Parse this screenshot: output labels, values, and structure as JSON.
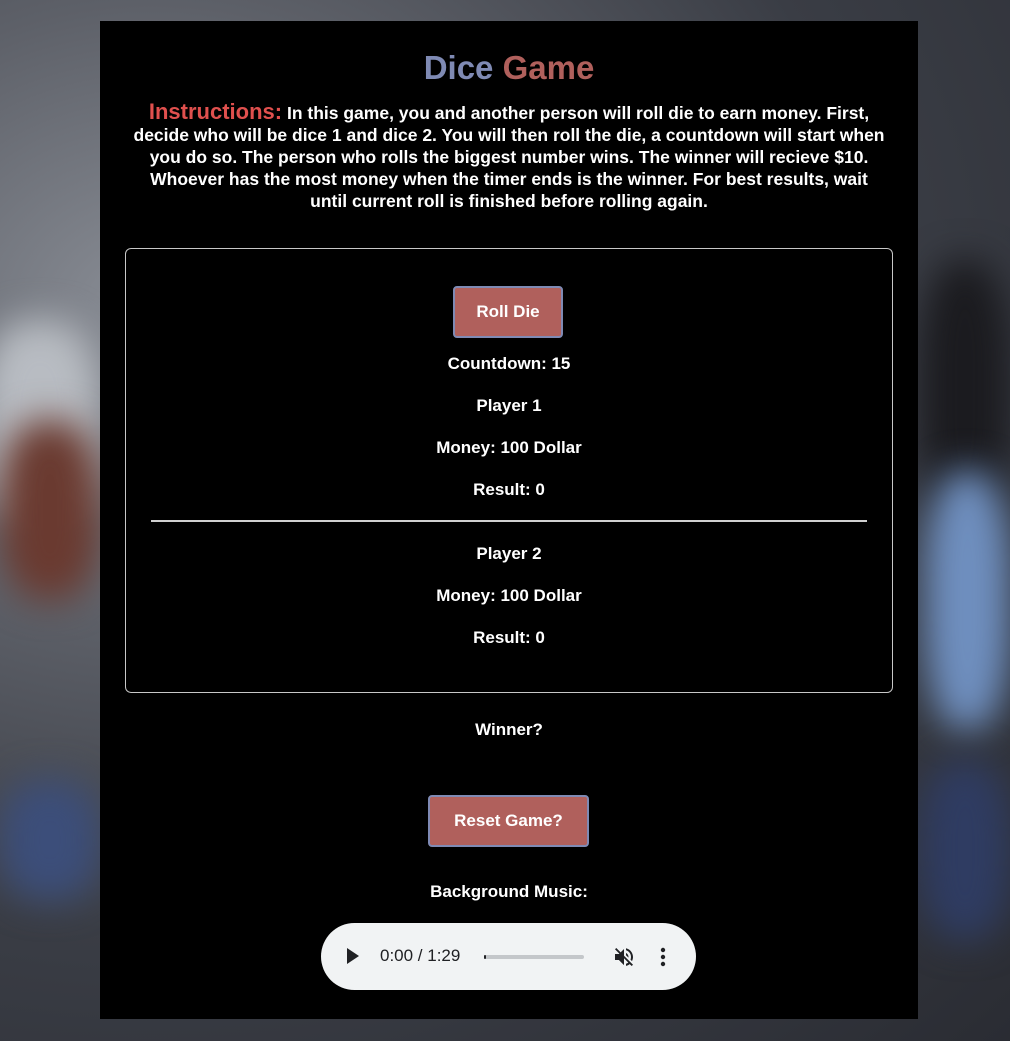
{
  "title": {
    "part1": "Dice",
    "part2": "Game"
  },
  "instructions": {
    "label": "Instructions:",
    "text": "In this game, you and another person will roll die to earn money. First, decide who will be dice 1 and dice 2. You will then roll the die, a countdown will start when you do so. The person who rolls the biggest number wins. The winner will recieve $10. Whoever has the most money when the timer ends is the winner. For best results, wait until current roll is finished before rolling again."
  },
  "game": {
    "roll_button": "Roll Die",
    "countdown": "Countdown: 15",
    "player1": {
      "name": "Player 1",
      "money": "Money: 100 Dollar",
      "result": "Result: 0"
    },
    "player2": {
      "name": "Player 2",
      "money": "Money: 100 Dollar",
      "result": "Result: 0"
    }
  },
  "winner": "Winner?",
  "reset_button": "Reset Game?",
  "music": {
    "label": "Background Music:",
    "time": "0:00 / 1:29",
    "progress": 0,
    "icons": {
      "play": "play-icon",
      "mute": "muted-speaker-icon",
      "more": "more-vertical-icon"
    }
  },
  "colors": {
    "title_part1": "#7f8ab4",
    "title_part2": "#b0605c",
    "instructions_label": "#e0504e",
    "button_bg": "#b0605c",
    "button_border": "#7f8ab4",
    "panel_bg": "#000000"
  }
}
